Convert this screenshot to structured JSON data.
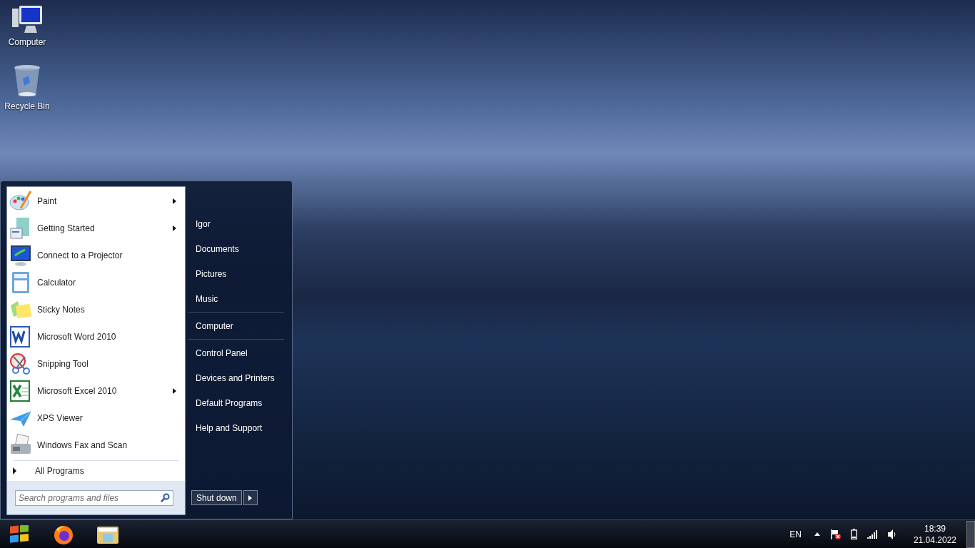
{
  "desktop_icons": [
    {
      "label": "Computer"
    },
    {
      "label": "Recycle Bin"
    }
  ],
  "start_menu": {
    "programs": [
      {
        "label": "Paint",
        "submenu": true
      },
      {
        "label": "Getting Started",
        "submenu": true
      },
      {
        "label": "Connect to a Projector",
        "submenu": false
      },
      {
        "label": "Calculator",
        "submenu": false
      },
      {
        "label": "Sticky Notes",
        "submenu": false
      },
      {
        "label": "Microsoft Word 2010",
        "submenu": false
      },
      {
        "label": "Snipping Tool",
        "submenu": false
      },
      {
        "label": "Microsoft Excel 2010",
        "submenu": true
      },
      {
        "label": "XPS Viewer",
        "submenu": false
      },
      {
        "label": "Windows Fax and Scan",
        "submenu": false
      }
    ],
    "all_programs": "All Programs",
    "search": {
      "placeholder": "Search programs and files"
    },
    "link_groups": [
      {
        "items": [
          "Igor",
          "Documents",
          "Pictures",
          "Music"
        ]
      },
      {
        "items": [
          "Computer"
        ]
      },
      {
        "items": [
          "Control Panel",
          "Devices and Printers",
          "Default Programs",
          "Help and Support"
        ]
      }
    ],
    "shutdown_button": "Shut down"
  },
  "taskbar": {
    "language": "EN",
    "time": "18:39",
    "date": "21.04.2022"
  }
}
